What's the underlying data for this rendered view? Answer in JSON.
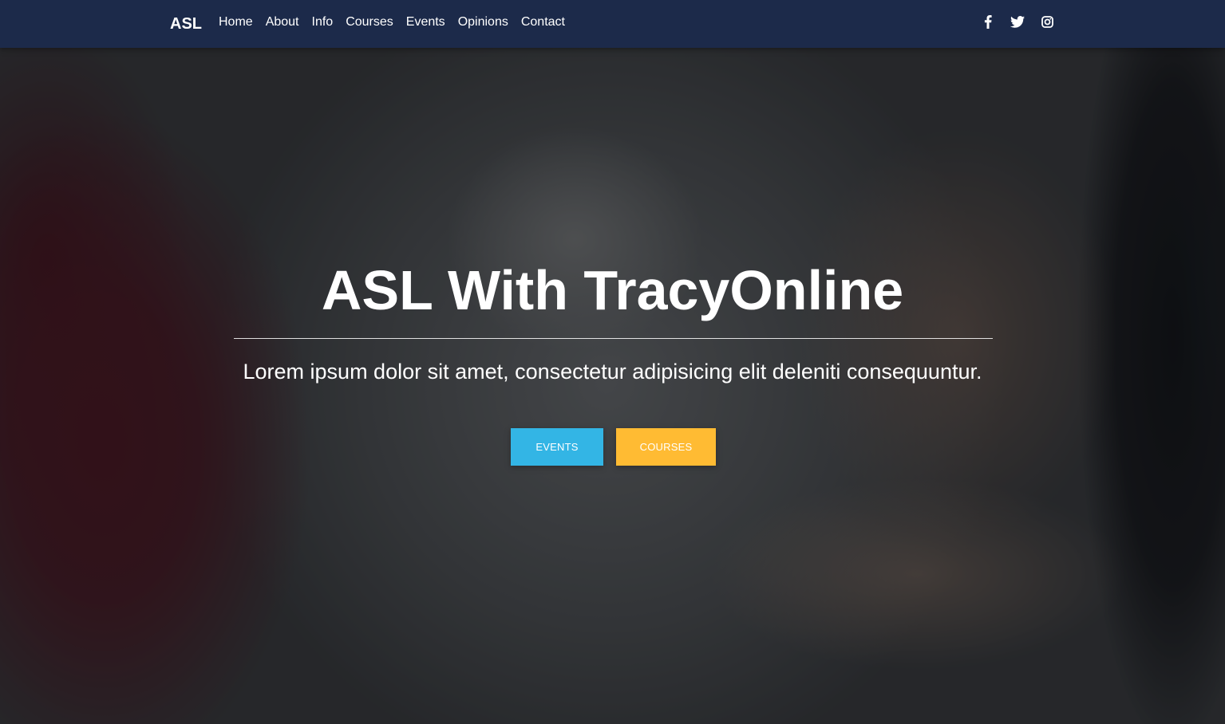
{
  "navbar": {
    "brand": "ASL",
    "links": [
      "Home",
      "About",
      "Info",
      "Courses",
      "Events",
      "Opinions",
      "Contact"
    ],
    "social_icons": [
      "facebook-icon",
      "twitter-icon",
      "instagram-icon"
    ],
    "background_color": "#1c2a4a"
  },
  "hero": {
    "title": "ASL With TracyOnline",
    "subtitle": "Lorem ipsum dolor sit amet, consectetur adipisicing elit deleniti consequuntur.",
    "buttons": {
      "events_label": "EVENTS",
      "courses_label": "COURSES"
    },
    "colors": {
      "events": "#33b5e5",
      "courses": "#ffbb33"
    }
  }
}
